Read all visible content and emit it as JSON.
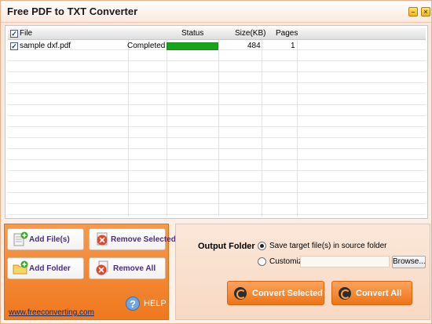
{
  "window": {
    "title": "Free PDF to TXT Converter",
    "min_glyph": "–",
    "close_glyph": "×"
  },
  "table": {
    "columns": [
      "File",
      "Status",
      "Size(KB)",
      "Pages"
    ],
    "rows": [
      {
        "checked": true,
        "file": "sample dxf.pdf",
        "state": "Completed",
        "progress": 1.0,
        "size": "484",
        "pages": "1"
      }
    ]
  },
  "buttons": {
    "add_files": "Add File(s)",
    "remove_selected": "Remove Selected",
    "add_folder": "Add Folder",
    "remove_all": "Remove All",
    "help": "HELP",
    "help_glyph": "?"
  },
  "footer_link": "www.freeconverting.com",
  "output": {
    "label": "Output Folder :",
    "option_source": "Save target file(s) in source folder",
    "option_custom": "Customize :",
    "custom_path": "",
    "browse": "Browse...",
    "selected": "source"
  },
  "actions": {
    "convert_selected": "Convert Selected",
    "convert_all": "Convert All"
  },
  "colors": {
    "accent": "#f0781e",
    "progress": "#17a617"
  }
}
